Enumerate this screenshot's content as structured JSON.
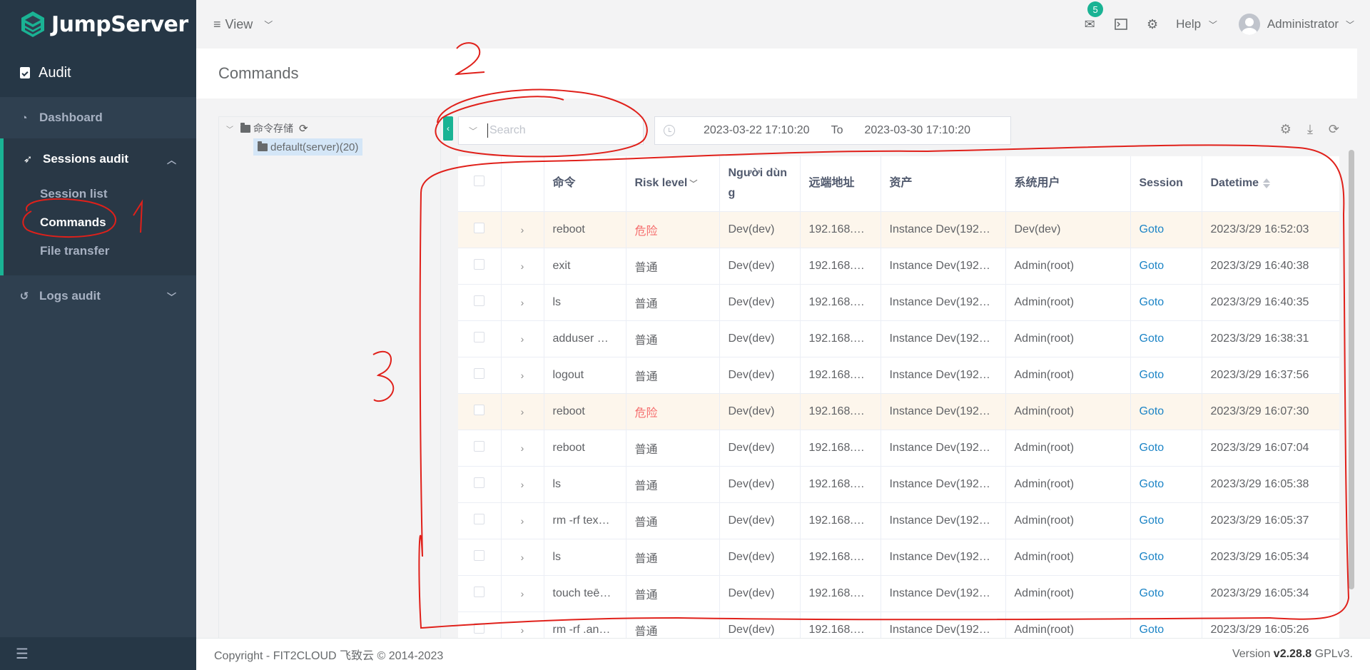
{
  "brand": {
    "name": "JumpServer"
  },
  "sidebar": {
    "section_title": "Audit",
    "items": [
      {
        "label": "Dashboard",
        "icon": "dashboard-icon"
      },
      {
        "label": "Sessions audit",
        "icon": "rocket-icon",
        "expanded": true,
        "children": [
          {
            "label": "Session list"
          },
          {
            "label": "Commands",
            "active": true
          },
          {
            "label": "File transfer"
          }
        ]
      },
      {
        "label": "Logs audit",
        "icon": "history-icon"
      }
    ]
  },
  "topbar": {
    "view_label": "View",
    "mail_badge": "5",
    "help_label": "Help",
    "user_name": "Administrator"
  },
  "page": {
    "title": "Commands"
  },
  "tree": {
    "root_label": "命令存储",
    "child_label": "default(server)(20)"
  },
  "filters": {
    "search_placeholder": "Search",
    "date_from": "2023-03-22 17:10:20",
    "date_to_label": "To",
    "date_to": "2023-03-30 17:10:20"
  },
  "table": {
    "columns": [
      "命令",
      "Risk level",
      "Người dùng",
      "远端地址",
      "资产",
      "系统用户",
      "Session",
      "Datetime"
    ],
    "rows": [
      {
        "command": "reboot",
        "risk": "危险",
        "user": "Dev(dev)",
        "remote": "192.168.…",
        "asset": "Instance Dev(192…",
        "system_user": "Dev(dev)",
        "session": "Goto",
        "datetime": "2023/3/29 16:52:03",
        "danger": true
      },
      {
        "command": "exit",
        "risk": "普通",
        "user": "Dev(dev)",
        "remote": "192.168.…",
        "asset": "Instance Dev(192…",
        "system_user": "Admin(root)",
        "session": "Goto",
        "datetime": "2023/3/29 16:40:38"
      },
      {
        "command": "ls",
        "risk": "普通",
        "user": "Dev(dev)",
        "remote": "192.168.…",
        "asset": "Instance Dev(192…",
        "system_user": "Admin(root)",
        "session": "Goto",
        "datetime": "2023/3/29 16:40:35"
      },
      {
        "command": "adduser …",
        "risk": "普通",
        "user": "Dev(dev)",
        "remote": "192.168.…",
        "asset": "Instance Dev(192…",
        "system_user": "Admin(root)",
        "session": "Goto",
        "datetime": "2023/3/29 16:38:31"
      },
      {
        "command": "logout",
        "risk": "普通",
        "user": "Dev(dev)",
        "remote": "192.168.…",
        "asset": "Instance Dev(192…",
        "system_user": "Admin(root)",
        "session": "Goto",
        "datetime": "2023/3/29 16:37:56"
      },
      {
        "command": "reboot",
        "risk": "危险",
        "user": "Dev(dev)",
        "remote": "192.168.…",
        "asset": "Instance Dev(192…",
        "system_user": "Admin(root)",
        "session": "Goto",
        "datetime": "2023/3/29 16:07:30",
        "danger": true
      },
      {
        "command": "reboot",
        "risk": "普通",
        "user": "Dev(dev)",
        "remote": "192.168.…",
        "asset": "Instance Dev(192…",
        "system_user": "Admin(root)",
        "session": "Goto",
        "datetime": "2023/3/29 16:07:04"
      },
      {
        "command": "ls",
        "risk": "普通",
        "user": "Dev(dev)",
        "remote": "192.168.…",
        "asset": "Instance Dev(192…",
        "system_user": "Admin(root)",
        "session": "Goto",
        "datetime": "2023/3/29 16:05:38"
      },
      {
        "command": "rm -rf tex…",
        "risk": "普通",
        "user": "Dev(dev)",
        "remote": "192.168.…",
        "asset": "Instance Dev(192…",
        "system_user": "Admin(root)",
        "session": "Goto",
        "datetime": "2023/3/29 16:05:37"
      },
      {
        "command": "ls",
        "risk": "普通",
        "user": "Dev(dev)",
        "remote": "192.168.…",
        "asset": "Instance Dev(192…",
        "system_user": "Admin(root)",
        "session": "Goto",
        "datetime": "2023/3/29 16:05:34"
      },
      {
        "command": "touch teē…",
        "risk": "普通",
        "user": "Dev(dev)",
        "remote": "192.168.…",
        "asset": "Instance Dev(192…",
        "system_user": "Admin(root)",
        "session": "Goto",
        "datetime": "2023/3/29 16:05:34"
      },
      {
        "command": "rm -rf .an…",
        "risk": "普通",
        "user": "Dev(dev)",
        "remote": "192.168.…",
        "asset": "Instance Dev(192…",
        "system_user": "Admin(root)",
        "session": "Goto",
        "datetime": "2023/3/29 16:05:26"
      }
    ]
  },
  "footer": {
    "copyright": "Copyright - FIT2CLOUD 飞致云 © 2014-2023",
    "version_prefix": "Version ",
    "version": "v2.28.8",
    "license": " GPLv3."
  },
  "annotations": [
    "1",
    "2",
    "3"
  ],
  "colors": {
    "accent": "#1ab394",
    "sidebar": "#2f4050",
    "danger": "#f56c6c",
    "link": "#1c84c6",
    "annotation": "#e0201a"
  }
}
